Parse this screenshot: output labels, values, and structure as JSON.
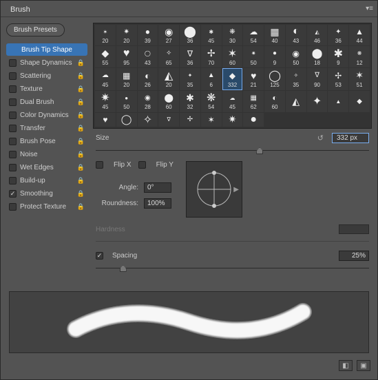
{
  "panel": {
    "title": "Brush"
  },
  "presets_button": "Brush Presets",
  "options": [
    {
      "label": "Brush Tip Shape",
      "checked": null,
      "locked": false,
      "selected": true
    },
    {
      "label": "Shape Dynamics",
      "checked": false,
      "locked": true
    },
    {
      "label": "Scattering",
      "checked": false,
      "locked": true
    },
    {
      "label": "Texture",
      "checked": false,
      "locked": true
    },
    {
      "label": "Dual Brush",
      "checked": false,
      "locked": true
    },
    {
      "label": "Color Dynamics",
      "checked": false,
      "locked": true
    },
    {
      "label": "Transfer",
      "checked": false,
      "locked": true
    },
    {
      "label": "Brush Pose",
      "checked": false,
      "locked": true
    },
    {
      "label": "Noise",
      "checked": false,
      "locked": true
    },
    {
      "label": "Wet Edges",
      "checked": false,
      "locked": true
    },
    {
      "label": "Build-up",
      "checked": false,
      "locked": true
    },
    {
      "label": "Smoothing",
      "checked": true,
      "locked": true
    },
    {
      "label": "Protect Texture",
      "checked": false,
      "locked": true
    }
  ],
  "thumbs": [
    "20",
    "20",
    "39",
    "27",
    "36",
    "45",
    "30",
    "54",
    "40",
    "43",
    "46",
    "36",
    "44",
    "55",
    "95",
    "43",
    "65",
    "36",
    "70",
    "60",
    "50",
    "9",
    "50",
    "18",
    "9",
    "12",
    "45",
    "20",
    "26",
    "20",
    "35",
    "6",
    "332",
    "21",
    "125",
    "35",
    "90",
    "53",
    "51",
    "45",
    "50",
    "28",
    "60",
    "32",
    "54",
    "45",
    "62",
    "60",
    "",
    "",
    "",
    "",
    "",
    "",
    "",
    "",
    "",
    "",
    "",
    ""
  ],
  "thumb_selected_index": 32,
  "size": {
    "label": "Size",
    "value": "332 px",
    "pos": 60
  },
  "flipx": {
    "label": "Flip X",
    "checked": false
  },
  "flipy": {
    "label": "Flip Y",
    "checked": false
  },
  "angle": {
    "label": "Angle:",
    "value": "0°"
  },
  "roundness": {
    "label": "Roundness:",
    "value": "100%"
  },
  "hardness": {
    "label": "Hardness"
  },
  "spacing": {
    "label": "Spacing",
    "checked": true,
    "value": "25%",
    "pos": 10
  }
}
